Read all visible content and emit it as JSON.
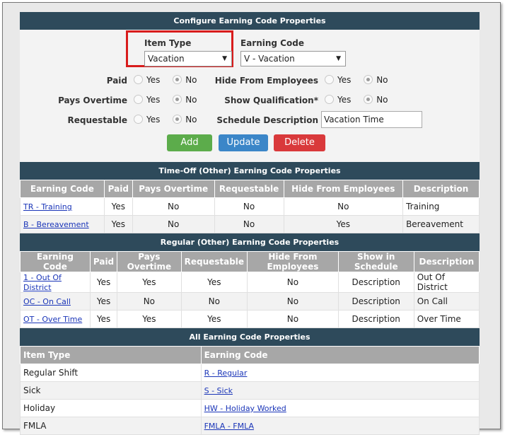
{
  "config": {
    "title": "Configure Earning Code Properties",
    "item_type_label": "Item Type",
    "item_type_value": "Vacation",
    "earning_code_label": "Earning Code",
    "earning_code_value": "V - Vacation",
    "yes": "Yes",
    "no": "No",
    "paid_label": "Paid",
    "pays_overtime_label": "Pays Overtime",
    "requestable_label": "Requestable",
    "hide_label": "Hide From Employees",
    "show_qual_label": "Show Qualification*",
    "schedule_desc_label": "Schedule Description",
    "schedule_desc_value": "Vacation Time",
    "add_label": "Add",
    "update_label": "Update",
    "delete_label": "Delete",
    "colors": {
      "add": "#5cac4b",
      "update": "#3b86c8",
      "delete": "#d9393b",
      "header": "#2e4a5b"
    }
  },
  "timeoff": {
    "title": "Time-Off (Other) Earning Code Properties",
    "headers": [
      "Earning Code",
      "Paid",
      "Pays Overtime",
      "Requestable",
      "Hide From Employees",
      "Description"
    ],
    "rows": [
      {
        "code": "TR - Training",
        "paid": "Yes",
        "overtime": "No",
        "requestable": "No",
        "hide": "No",
        "desc": "Training"
      },
      {
        "code": "B - Bereavement",
        "paid": "Yes",
        "overtime": "No",
        "requestable": "No",
        "hide": "Yes",
        "desc": "Bereavement"
      }
    ]
  },
  "regular": {
    "title": "Regular (Other) Earning Code Properties",
    "headers": [
      "Earning Code",
      "Paid",
      "Pays Overtime",
      "Requestable",
      "Hide From Employees",
      "Show in Schedule",
      "Description"
    ],
    "rows": [
      {
        "code": "1 - Out Of District",
        "paid": "Yes",
        "overtime": "Yes",
        "requestable": "Yes",
        "hide": "No",
        "show": "Description",
        "desc": "Out Of District"
      },
      {
        "code": "OC - On Call",
        "paid": "Yes",
        "overtime": "No",
        "requestable": "No",
        "hide": "No",
        "show": "Description",
        "desc": "On Call"
      },
      {
        "code": "OT - Over Time",
        "paid": "Yes",
        "overtime": "Yes",
        "requestable": "Yes",
        "hide": "No",
        "show": "Description",
        "desc": "Over Time"
      }
    ]
  },
  "all": {
    "title": "All Earning Code Properties",
    "headers": [
      "Item Type",
      "Earning Code"
    ],
    "rows": [
      {
        "item": "Regular Shift",
        "code": "R - Regular"
      },
      {
        "item": "Sick",
        "code": "S - Sick"
      },
      {
        "item": "Holiday",
        "code": "HW - Holiday Worked"
      },
      {
        "item": "FMLA",
        "code": "FMLA - FMLA"
      }
    ]
  }
}
